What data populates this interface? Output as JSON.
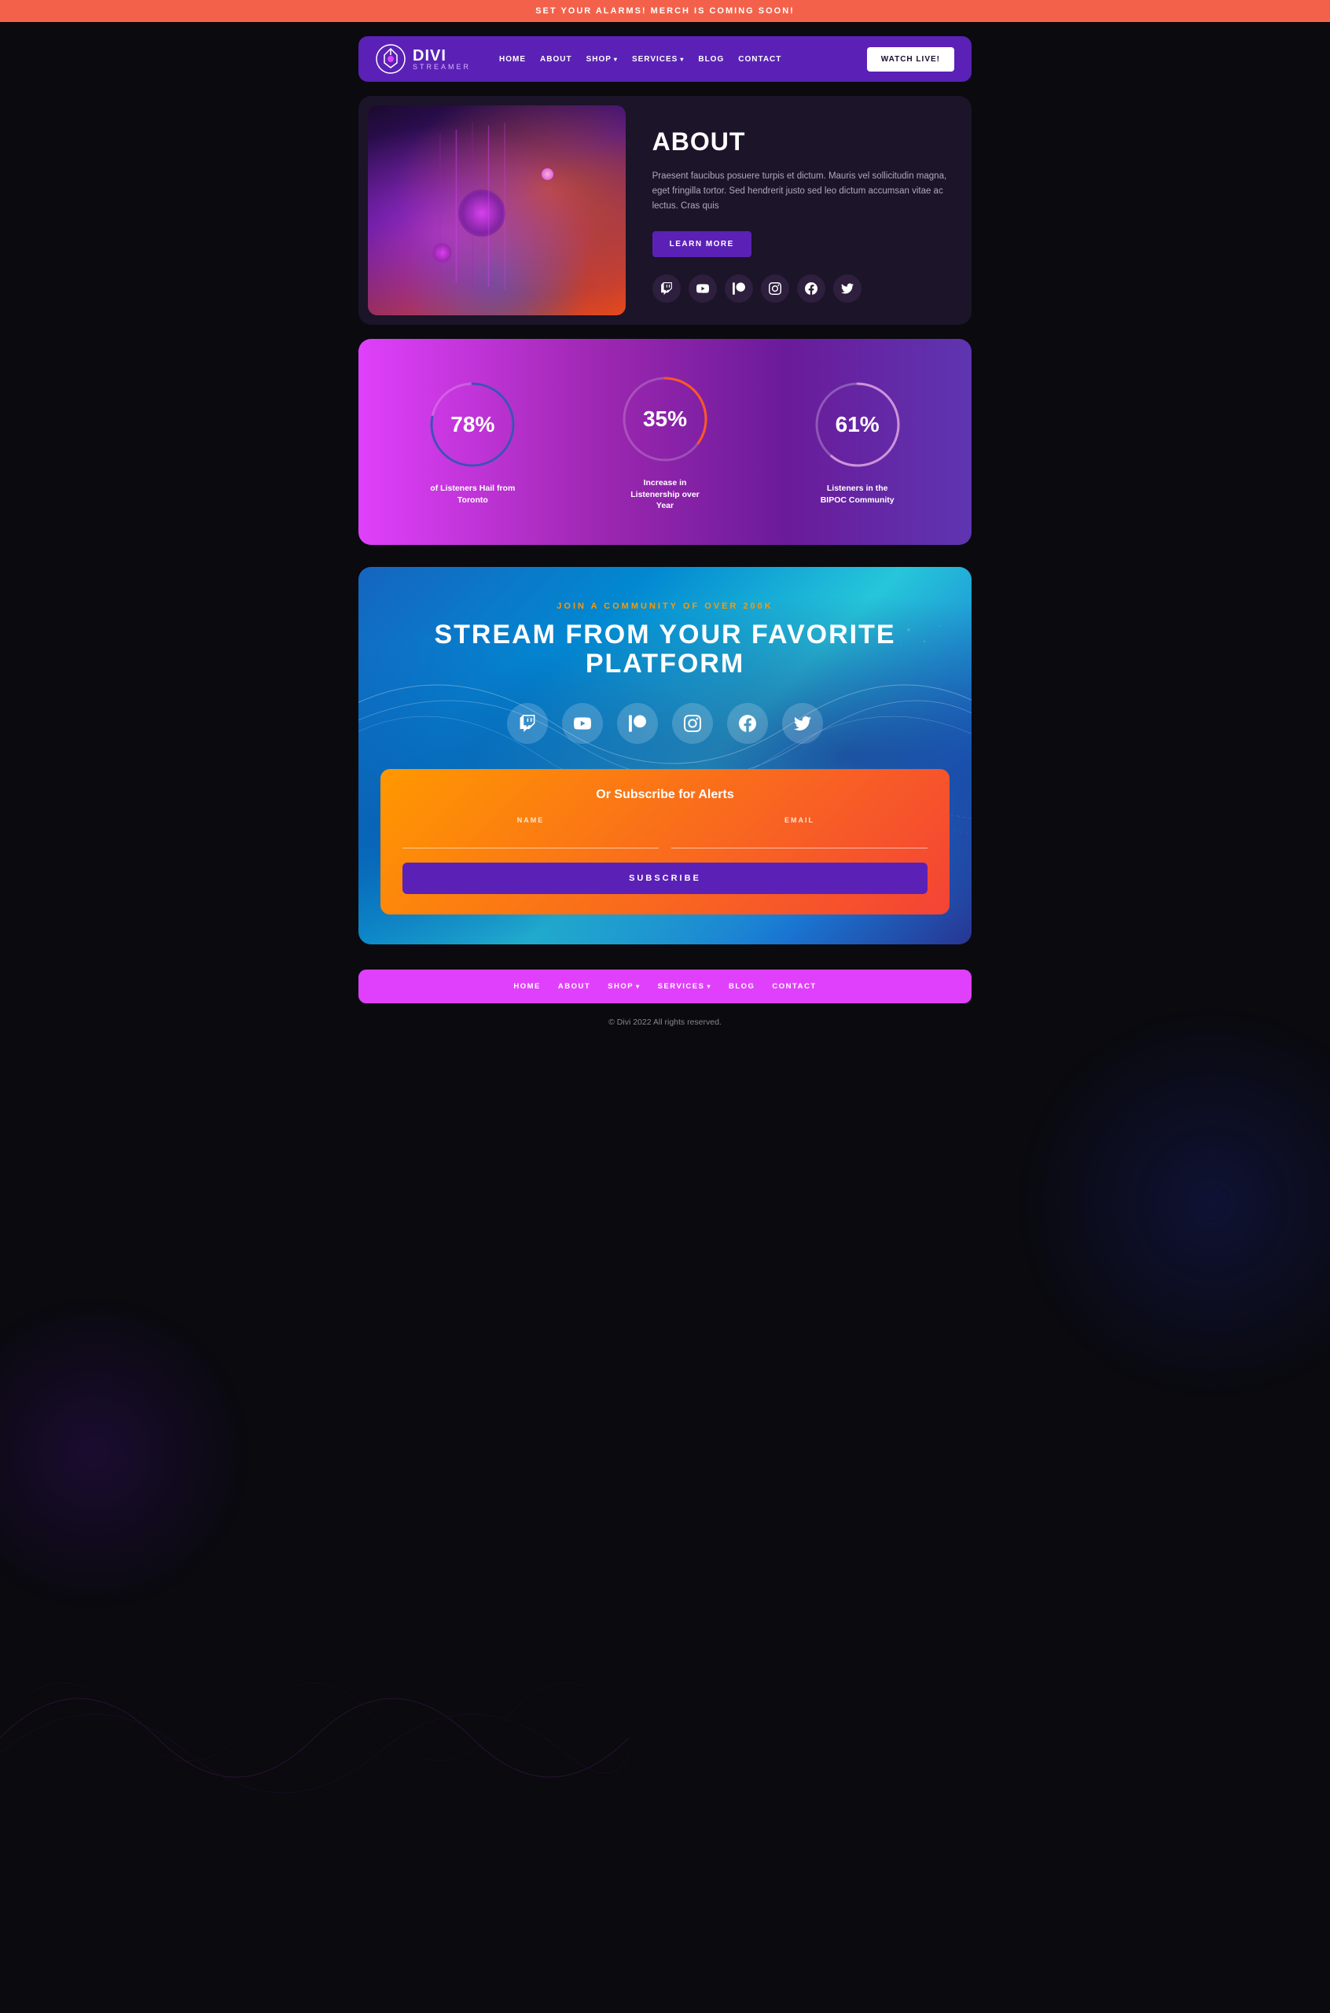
{
  "topBanner": {
    "text": "SET YOUR ALARMS! MERCH IS COMING SOON!"
  },
  "navbar": {
    "logo": {
      "brand": "DIVI",
      "tagline": "STREAMER"
    },
    "links": [
      {
        "label": "HOME",
        "hasDropdown": false
      },
      {
        "label": "ABOUT",
        "hasDropdown": false
      },
      {
        "label": "SHOP",
        "hasDropdown": true
      },
      {
        "label": "SERVICES",
        "hasDropdown": true
      },
      {
        "label": "BLOG",
        "hasDropdown": false
      },
      {
        "label": "CONTACT",
        "hasDropdown": false
      }
    ],
    "ctaLabel": "WATCH LIVE!"
  },
  "about": {
    "title": "ABOUT",
    "description": "Praesent faucibus posuere turpis et dictum. Mauris vel sollicitudin magna, eget fringilla tortor. Sed hendrerit justo sed leo dictum accumsan vitae ac lectus. Cras quis",
    "btnLabel": "LEARN MORE"
  },
  "stats": [
    {
      "value": "78%",
      "label": "of Listeners Hail from Toronto",
      "percent": 78,
      "color1": "#e040fb",
      "color2": "#3f51b5"
    },
    {
      "value": "35%",
      "label": "Increase in Listenership over Year",
      "percent": 35,
      "color1": "#ff5722",
      "color2": "#9c27b0"
    },
    {
      "value": "61%",
      "label": "Listeners in the BIPOC Community",
      "percent": 61,
      "color1": "#ce93d8",
      "color2": "#7b1fa2"
    }
  ],
  "stream": {
    "subtitle": "JOIN A COMMUNITY OF OVER 200K",
    "title": "STREAM FROM YOUR FAVORITE PLATFORM"
  },
  "subscribe": {
    "title": "Or Subscribe for Alerts",
    "namePlaceholder": "",
    "emailPlaceholder": "",
    "nameLabel": "NAME",
    "emailLabel": "EMAIL",
    "btnLabel": "SUBSCRIBE"
  },
  "footerNav": {
    "links": [
      {
        "label": "HOME",
        "hasDropdown": false
      },
      {
        "label": "ABOUT",
        "hasDropdown": false
      },
      {
        "label": "SHOP",
        "hasDropdown": true
      },
      {
        "label": "SERVICES",
        "hasDropdown": true
      },
      {
        "label": "BLOG",
        "hasDropdown": false
      },
      {
        "label": "CONTACT",
        "hasDropdown": false
      }
    ]
  },
  "footerCopy": "© Divi 2022 All rights reserved.",
  "icons": {
    "twitch": "𝕋",
    "youtube": "▶",
    "patreon": "⬛",
    "instagram": "◻",
    "facebook": "f",
    "twitter": "🐦"
  }
}
